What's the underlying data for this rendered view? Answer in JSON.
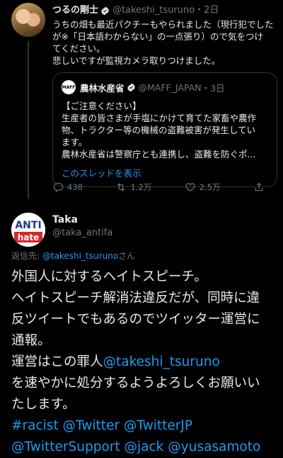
{
  "tweet1": {
    "name": "つるの剛士",
    "handle": "@takeshi_tsuruno",
    "time": "・2日",
    "lines": [
      "うちの畑も最近パクチーもやられました（現行犯でした",
      "が※「日本語わからない」の一点張り）ので気をつけ",
      "てください。",
      "悲しいですが監視カメラ取りつけました。"
    ],
    "quote": {
      "logo_text": "MAFF",
      "name": "農林水産省",
      "handle": "@MAFF_JAPAN",
      "time": "・3日",
      "lines": [
        "【ご注意ください】",
        "生産者の皆さまが手塩にかけて育てた家畜や農作",
        "物、トラクター等の機械の盗難被害が発生してい",
        "ます。",
        "農林水産省は警察庁とも連携し、盗難を防ぐポ..."
      ],
      "show_thread": "このスレッドを表示"
    },
    "actions": {
      "reply_count": "438",
      "retweet_count": "1.2万",
      "like_count": "2.5万"
    }
  },
  "tweet2": {
    "avatar_text_top": "ANTI",
    "avatar_text_bottom": "hate",
    "name": "Taka",
    "handle": "@taka_antifa",
    "reply_prefix": "返信先: ",
    "reply_handle": "@takeshi_tsuruno",
    "reply_suffix": "さん",
    "text": {
      "line1": "外国人に対するヘイトスピーチ。",
      "line2": "ヘイトスピーチ解消法違反だが、同時に違",
      "line3": "反ツイートでもあるのでツイッター運営に",
      "line4": "通報。",
      "line5_a": "運営はこの罪人",
      "line5_mention": "@takeshi_tsuruno",
      "line6": "を速やかに処分するようよろしくお願いい",
      "line7": "たします。",
      "tags1": "#racist @Twitter @TwitterJP",
      "tags2": "@TwitterSupport @jack @yusasamoto"
    }
  },
  "colors": {
    "background": "#000000",
    "text": "#e7e9ea",
    "secondary": "#71767b",
    "link": "#1d9bf0",
    "border": "#2f3336"
  }
}
